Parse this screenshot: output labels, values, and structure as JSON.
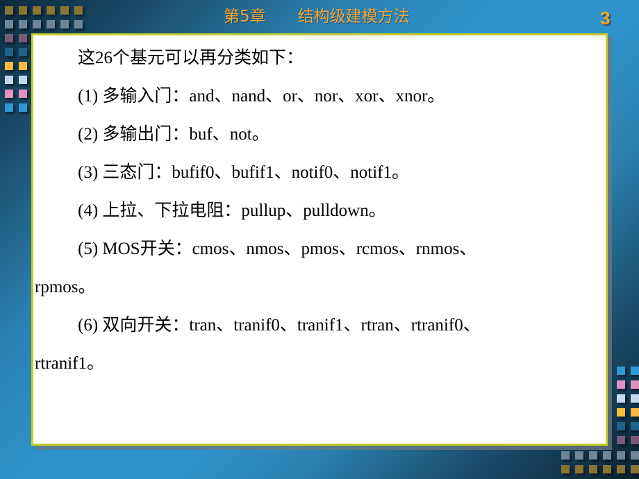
{
  "header": {
    "chapter": "第5章",
    "title": "结构级建模方法",
    "page_number": "3"
  },
  "content": {
    "lines": [
      "这26个基元可以再分类如下：",
      "(1) 多输入门：and、nand、or、nor、xor、xnor。",
      "(2) 多输出门：buf、not。",
      "(3) 三态门：bufif0、bufif1、notif0、notif1。",
      "(4) 上拉、下拉电阻：pullup、pulldown。",
      "(5)  MOS开关：cmos、nmos、pmos、rcmos、rnmos、",
      "rpmos。",
      "(6) 双向开关：tran、tranif0、tranif1、rtran、rtranif0、",
      "rtranif1。"
    ]
  },
  "colors": {
    "header_text": "#f3a63a",
    "frame_border": "#c4cc28",
    "squares": {
      "gold": "#8a7433",
      "grey_blue": "#6f8598",
      "mauve": "#7a5a78",
      "teal": "#1f6488",
      "bright_gold": "#f8bb3f",
      "light_blue": "#c4d8ee",
      "pink": "#e290c0",
      "cyan": "#2e9ad4"
    }
  }
}
